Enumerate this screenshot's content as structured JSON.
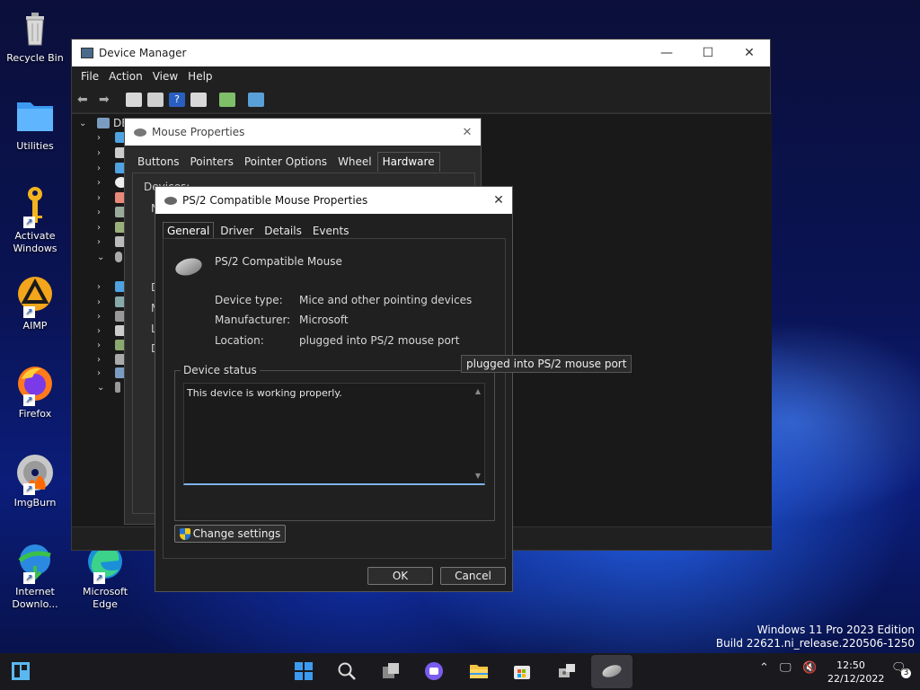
{
  "desktop": {
    "icons": [
      {
        "label": "Recycle Bin",
        "icon": "recycle-bin-icon"
      },
      {
        "label": "Utilities",
        "icon": "folder-icon"
      },
      {
        "label": "Activate Windows",
        "icon": "key-icon"
      },
      {
        "label": "AIMP",
        "icon": "aimp-icon"
      },
      {
        "label": "Firefox",
        "icon": "firefox-icon"
      },
      {
        "label": "ImgBurn",
        "icon": "imgburn-icon"
      },
      {
        "label": "Internet Downlo...",
        "icon": "internet-download-manager-icon"
      },
      {
        "label": "Microsoft Edge",
        "icon": "edge-icon"
      }
    ],
    "watermark": {
      "line1": "Windows 11 Pro 2023 Edition",
      "line2": "Build 22621.ni_release.220506-1250"
    }
  },
  "device_manager": {
    "title": "Device Manager",
    "menu": [
      "File",
      "Action",
      "View",
      "Help"
    ],
    "tree_root_fragment": "DE"
  },
  "mouse_properties": {
    "title": "Mouse Properties",
    "tabs": [
      "Buttons",
      "Pointers",
      "Pointer Options",
      "Wheel",
      "Hardware"
    ],
    "active_tab": "Hardware",
    "partial_labels": {
      "devices": "Devices:",
      "n": "N",
      "d": "D",
      "m": "M",
      "l": "L",
      "d2": "D"
    }
  },
  "ps2_dialog": {
    "title": "PS/2 Compatible Mouse Properties",
    "tabs": [
      "General",
      "Driver",
      "Details",
      "Events"
    ],
    "active_tab": "General",
    "device_name": "PS/2 Compatible Mouse",
    "properties": [
      {
        "label": "Device type:",
        "value": "Mice and other pointing devices"
      },
      {
        "label": "Manufacturer:",
        "value": "Microsoft"
      },
      {
        "label": "Location:",
        "value": "plugged into PS/2 mouse port"
      }
    ],
    "status_legend": "Device status",
    "status_text": "This device is working properly.",
    "change_settings_label": "Change settings",
    "ok_label": "OK",
    "cancel_label": "Cancel"
  },
  "tooltip": "plugged into PS/2 mouse port",
  "taskbar": {
    "clock_time": "12:50",
    "clock_date": "22/12/2022",
    "notification_count": "3",
    "apps": [
      "widgets-icon",
      "start-icon",
      "search-icon",
      "task-view-icon",
      "chat-icon",
      "file-explorer-icon",
      "store-icon",
      "device-manager-icon",
      "mouse-properties-icon"
    ]
  }
}
